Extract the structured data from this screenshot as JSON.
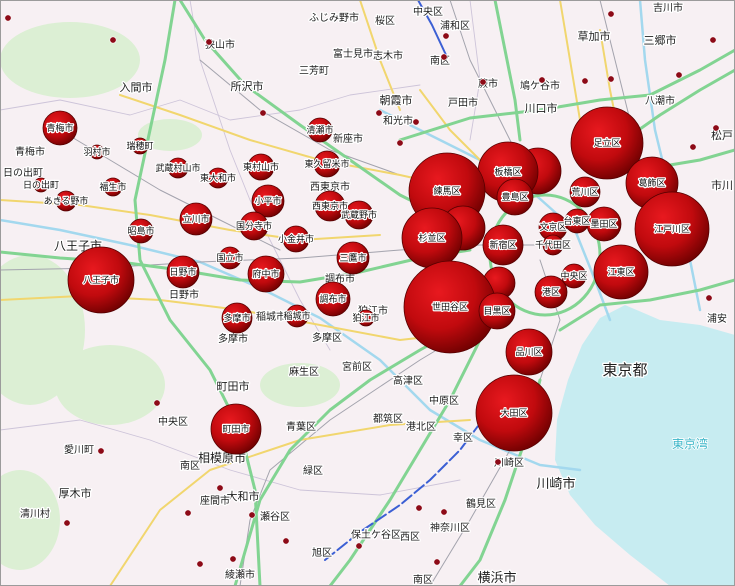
{
  "map": {
    "colors": {
      "land": "#f7f0f3",
      "park": "#dcefd4",
      "water": "#c7ecf1",
      "bubble_light": "#e8191f",
      "bubble_mid": "#c10a0e",
      "bubble_dark": "#6a0000",
      "bubble_edge": "#560000",
      "dot": "#8d0a17",
      "expressway": "#82d492",
      "major_road": "#f1d66e",
      "railway": "#a3a3ad",
      "shinkansen": "#3b5fd4",
      "river": "#a3d8ee",
      "boundary": "#cdc4d9",
      "water_label": "#3bb6c8",
      "frame": "#9b9b9b"
    },
    "bubbles": [
      {
        "label": "青梅市"
      },
      {
        "label": "羽村市"
      },
      {
        "label": "瑞穂町"
      },
      {
        "label": "福生市"
      },
      {
        "label": "日の出町"
      },
      {
        "label": "あきる野市"
      },
      {
        "label": "武蔵村山市"
      },
      {
        "label": "東大和市"
      },
      {
        "label": "東村山市"
      },
      {
        "label": "清瀬市"
      },
      {
        "label": "東久留米市"
      },
      {
        "label": "小平市"
      },
      {
        "label": "西東京市"
      },
      {
        "label": "武蔵野市"
      },
      {
        "label": "立川市"
      },
      {
        "label": "昭島市"
      },
      {
        "label": "国分寺市"
      },
      {
        "label": "小金井市"
      },
      {
        "label": "三鷹市"
      },
      {
        "label": "国立市"
      },
      {
        "label": "日野市"
      },
      {
        "label": "府中市"
      },
      {
        "label": "八王子市"
      },
      {
        "label": "調布市"
      },
      {
        "label": "狛江市"
      },
      {
        "label": "稲城市"
      },
      {
        "label": "多摩市"
      },
      {
        "label": "町田市"
      },
      {
        "label": "練馬区"
      },
      {
        "label": "板橋区"
      },
      {
        "label": "豊島区"
      },
      {
        "label": "足立区"
      },
      {
        "label": "荒川区"
      },
      {
        "label": "葛飾区"
      },
      {
        "label": "江戸川区"
      },
      {
        "label": "杉並区"
      },
      {
        "label": "新宿区"
      },
      {
        "label": "文京区"
      },
      {
        "label": "台東区"
      },
      {
        "label": "墨田区"
      },
      {
        "label": "千代田区"
      },
      {
        "label": "中央区"
      },
      {
        "label": "江東区"
      },
      {
        "label": "港区"
      },
      {
        "label": "世田谷区"
      },
      {
        "label": "目黒区"
      },
      {
        "label": "品川区"
      },
      {
        "label": "大田区"
      }
    ],
    "places": [
      "狭山市",
      "所沢市",
      "入間市",
      "三芳町",
      "富士見市",
      "ふじみ野市",
      "志木市",
      "朝霞市",
      "和光市",
      "新座市",
      "桜区",
      "中央区",
      "浦和区",
      "南区",
      "蕨市",
      "戸田市",
      "鳩ケ谷市",
      "川口市",
      "草加市",
      "三郷市",
      "吉川市",
      "八潮市",
      "松戸",
      "市川",
      "浦安",
      "西東京市",
      "青梅市",
      "日の出町",
      "八王子市",
      "日野市",
      "調布市",
      "狛江市",
      "稲城市",
      "多摩市",
      "多摩区",
      "麻生区",
      "宮前区",
      "高津区",
      "中原区",
      "都筑区",
      "港北区",
      "青葉区",
      "町田市",
      "中央区",
      "愛川町",
      "相模原市",
      "南区",
      "幸区",
      "川崎区",
      "川崎市",
      "緑区",
      "厚木市",
      "大和市",
      "座間市",
      "鶴見区",
      "清川村",
      "瀬谷区",
      "神奈川区",
      "保土ケ谷区",
      "西区",
      "旭区",
      "綾瀬市",
      "南区",
      "横浜市",
      "東京都"
    ],
    "water_label": "東京湾"
  }
}
